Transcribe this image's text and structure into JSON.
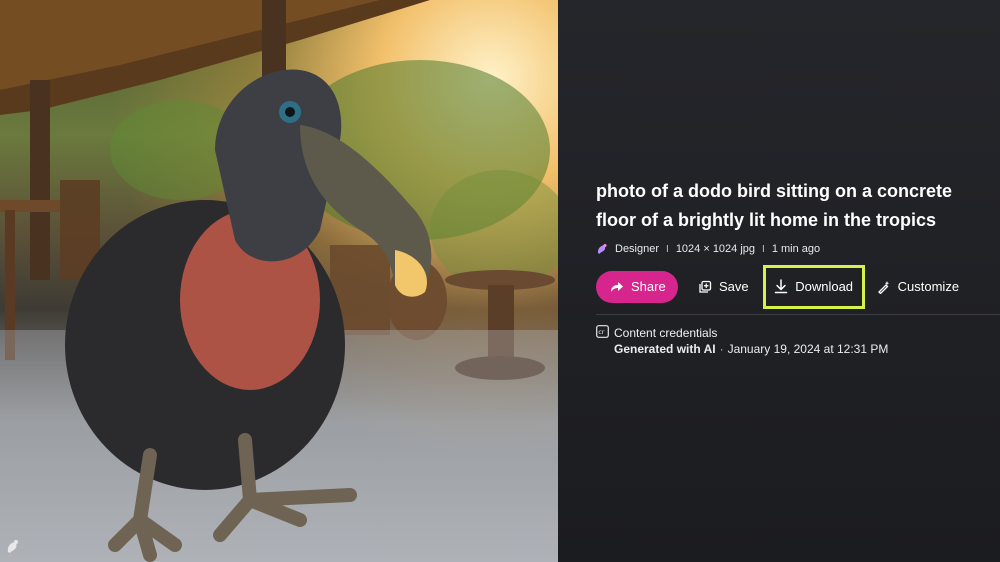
{
  "image": {
    "watermark_icon": "designer-logo-icon",
    "description_icon": "dodo-bird-photo"
  },
  "details": {
    "title": "photo of a dodo bird sitting on a concrete floor of a brightly lit home in the tropics",
    "meta": {
      "app_icon": "designer-icon",
      "app": "Designer",
      "separator": "I",
      "dimensions": "1024 × 1024 jpg",
      "time": "1 min ago"
    },
    "actions": {
      "share": {
        "label": "Share",
        "icon": "share-icon",
        "color": "#d6268e"
      },
      "save": {
        "label": "Save",
        "icon": "save-collection-icon"
      },
      "download": {
        "label": "Download",
        "icon": "download-icon",
        "highlight_color": "#d4f24a"
      },
      "customize": {
        "label": "Customize",
        "icon": "magic-pen-icon"
      }
    },
    "credentials": {
      "icon": "content-credentials-icon",
      "label": "Content credentials",
      "generated": "Generated with AI",
      "separator": "·",
      "date": "January 19, 2024 at 12:31 PM"
    }
  }
}
